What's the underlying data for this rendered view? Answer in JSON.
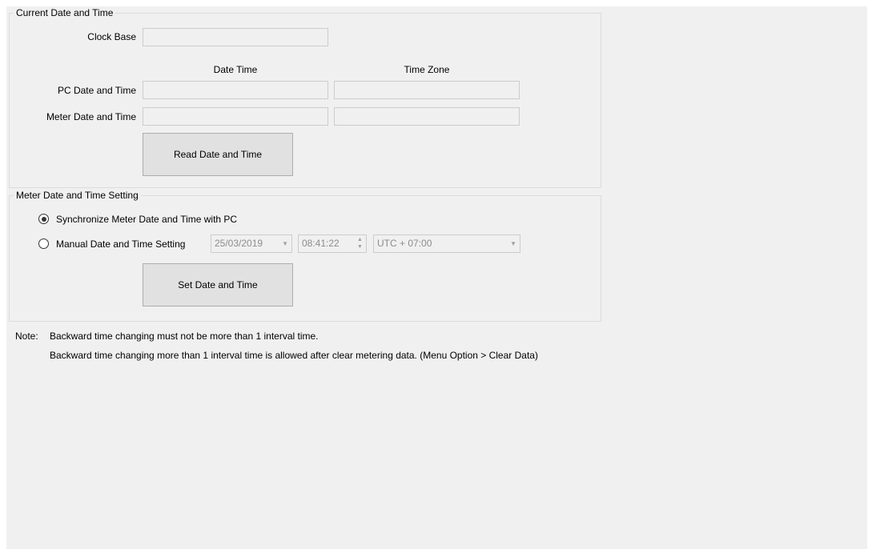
{
  "current": {
    "title": "Current Date and Time",
    "clock_base_label": "Clock Base",
    "clock_base_value": "",
    "col_date_time": "Date Time",
    "col_time_zone": "Time Zone",
    "pc_label": "PC Date and Time",
    "pc_date_value": "",
    "pc_zone_value": "",
    "meter_label": "Meter Date and Time",
    "meter_date_value": "",
    "meter_zone_value": "",
    "read_button": "Read Date and Time"
  },
  "setting": {
    "title": "Meter Date and Time Setting",
    "sync_label": "Synchronize Meter Date and Time with PC",
    "sync_selected": true,
    "manual_label": "Manual Date and Time Setting",
    "manual_date": "25/03/2019",
    "manual_time": "08:41:22",
    "manual_zone": "UTC + 07:00",
    "set_button": "Set Date and Time"
  },
  "note": {
    "prefix": "Note:",
    "line1": "Backward time changing must not be more than 1 interval time.",
    "line2": "Backward time changing more than 1 interval time is allowed after clear metering data. (Menu Option > Clear Data)"
  }
}
